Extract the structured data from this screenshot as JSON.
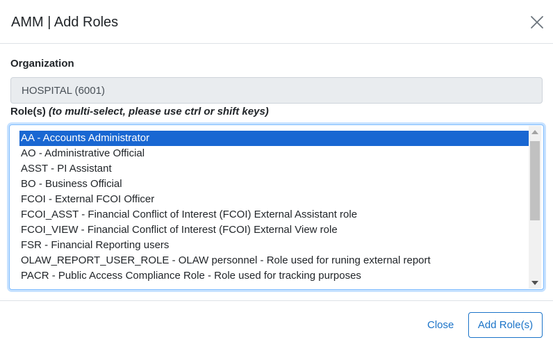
{
  "header": {
    "title": "AMM | Add Roles",
    "close_icon": "close-icon"
  },
  "form": {
    "organization_label": "Organization",
    "organization_value": "HOSPITAL (6001)",
    "roles_label": "Role(s)",
    "roles_hint": "(to multi-select, please use ctrl or shift keys)",
    "roles": [
      {
        "label": "AA - Accounts Administrator",
        "selected": true
      },
      {
        "label": "AO - Administrative Official",
        "selected": false
      },
      {
        "label": "ASST - PI Assistant",
        "selected": false
      },
      {
        "label": "BO - Business Official",
        "selected": false
      },
      {
        "label": "FCOI - External FCOI Officer",
        "selected": false
      },
      {
        "label": "FCOI_ASST - Financial Conflict of Interest (FCOI) External Assistant role",
        "selected": false
      },
      {
        "label": "FCOI_VIEW - Financial Conflict of Interest (FCOI) External View role",
        "selected": false
      },
      {
        "label": "FSR - Financial Reporting users",
        "selected": false
      },
      {
        "label": "OLAW_REPORT_USER_ROLE - OLAW personnel - Role used for runing external report",
        "selected": false
      },
      {
        "label": "PACR - Public Access Compliance Role - Role used for tracking purposes",
        "selected": false
      }
    ]
  },
  "footer": {
    "close_label": "Close",
    "add_label": "Add Role(s)"
  },
  "colors": {
    "accent": "#1a73c8",
    "selected_bg": "#1967d2"
  }
}
